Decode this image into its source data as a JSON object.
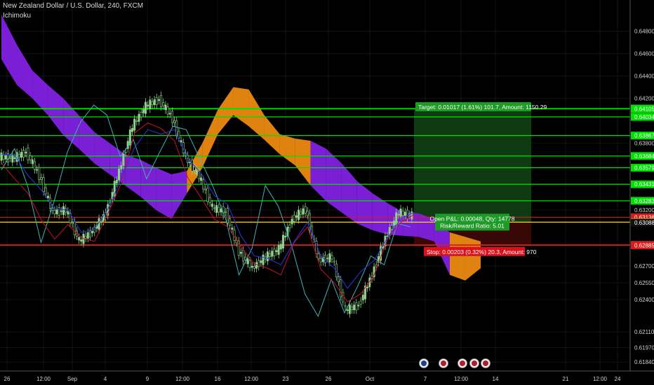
{
  "header": {
    "symbol_line": "New Zealand Dollar / U.S. Dollar, 240, FXCM",
    "indicator": "Ichimoku"
  },
  "colors": {
    "background": "#000000",
    "cloud_bearish": "#7a1fd6",
    "cloud_bullish": "#e0820f",
    "conversion_line": "#2c34e0",
    "base_line": "#c8102e",
    "lagging_span": "#3fb3b3",
    "candle": "#8fd18a",
    "level_green": "#00e000",
    "level_red": "#d81b1b",
    "level_yellow": "#ffd400",
    "profit_zone": "#0f3a12",
    "loss_zone": "#3a0707",
    "axis_text": "#cfcfcf"
  },
  "chart_data": {
    "type": "line",
    "title": "New Zealand Dollar / U.S. Dollar, 240, FXCM",
    "x_ticks": [
      "26",
      "12:00",
      "Sep",
      "4",
      "9",
      "12:00",
      "16",
      "12:00",
      "23",
      "26",
      "Oct",
      "7",
      "12:00",
      "14",
      "21",
      "12:00",
      "24"
    ],
    "y_ticks": [
      0.6184,
      0.6197,
      0.6211,
      0.624,
      0.6255,
      0.627,
      0.6308,
      0.632,
      0.638,
      0.642,
      0.644,
      0.646,
      0.648
    ],
    "y_tick_labels": [
      "0.61840",
      "0.61970",
      "0.62110",
      "0.62400",
      "0.62550",
      "0.62700",
      "0.63088",
      "0.63200",
      "0.63800",
      "0.64200",
      "0.64400",
      "0.64600",
      "0.64800"
    ],
    "ylim": [
      0.6176,
      0.6508
    ],
    "levels": [
      {
        "value": 0.64109,
        "label": "0.64109",
        "color": "green"
      },
      {
        "value": 0.64105,
        "label": "0.64105",
        "color": "green"
      },
      {
        "value": 0.64034,
        "label": "0.64034",
        "color": "green"
      },
      {
        "value": 0.63867,
        "label": "0.63867",
        "color": "green"
      },
      {
        "value": 0.63684,
        "label": "0.63684",
        "color": "green"
      },
      {
        "value": 0.63579,
        "label": "0.63579",
        "color": "green"
      },
      {
        "value": 0.63431,
        "label": "0.63431",
        "color": "green"
      },
      {
        "value": 0.63283,
        "label": "0.63283",
        "color": "green"
      },
      {
        "value": 0.63136,
        "label": "0.63136",
        "color": "red"
      },
      {
        "value": 0.63092,
        "label": "0.63092",
        "color": "yellow"
      },
      {
        "value": 0.62889,
        "label": "0.62889",
        "color": "red"
      },
      {
        "value": 0.62885,
        "label": "0.62885",
        "color": "red"
      }
    ],
    "current_price_label": "0.63088",
    "position": {
      "entry": 0.63092,
      "target": 0.64109,
      "stop": 0.62889,
      "target_text": "Target: 0.01017 (1.61%) 101.7, Amount: 1150.29",
      "open_text_1": "Open P&L: 0.00048, Qty: 14778",
      "open_text_2": "Risk/Reward Ratio: 5.01",
      "stop_text": "Stop: 0.00203 (0.32%) 20.3, Amount: 970"
    },
    "cloud_top": [
      0.6495,
      0.6468,
      0.6445,
      0.6432,
      0.642,
      0.6405,
      0.639,
      0.638,
      0.637,
      0.6365,
      0.6358,
      0.6352,
      0.6355,
      0.638,
      0.641,
      0.643,
      0.6428,
      0.6405,
      0.6388,
      0.6384,
      0.6382,
      0.6375,
      0.6362,
      0.6346,
      0.6335,
      0.6326,
      0.6318,
      0.6317,
      0.6312,
      0.63,
      0.6296,
      0.6292
    ],
    "cloud_bottom": [
      0.6455,
      0.6432,
      0.642,
      0.6405,
      0.6387,
      0.6375,
      0.6362,
      0.6352,
      0.6342,
      0.6332,
      0.632,
      0.6312,
      0.6335,
      0.6358,
      0.6388,
      0.6405,
      0.6395,
      0.6383,
      0.637,
      0.636,
      0.6342,
      0.6328,
      0.6318,
      0.6308,
      0.6302,
      0.6298,
      0.6297,
      0.6296,
      0.6292,
      0.6262,
      0.6257,
      0.6268
    ],
    "close": [
      0.6368,
      0.6366,
      0.6372,
      0.6351,
      0.6318,
      0.632,
      0.6292,
      0.6301,
      0.6317,
      0.6355,
      0.6395,
      0.6413,
      0.6419,
      0.6402,
      0.6367,
      0.635,
      0.6322,
      0.6318,
      0.6283,
      0.6268,
      0.6278,
      0.6285,
      0.6312,
      0.6321,
      0.6275,
      0.6278,
      0.623,
      0.6235,
      0.6262,
      0.6295,
      0.6318,
      0.6315
    ],
    "tenkan": [
      0.637,
      0.6369,
      0.6351,
      0.6338,
      0.6321,
      0.632,
      0.63,
      0.6303,
      0.6321,
      0.6348,
      0.6376,
      0.6392,
      0.6388,
      0.6392,
      0.6366,
      0.6353,
      0.6333,
      0.6325,
      0.6297,
      0.6279,
      0.6277,
      0.6271,
      0.6292,
      0.6309,
      0.6279,
      0.6268,
      0.625,
      0.6265,
      0.6275,
      0.6295,
      0.6312,
      0.6318
    ],
    "kijun": [
      0.6362,
      0.6348,
      0.6335,
      0.6311,
      0.6294,
      0.6307,
      0.6295,
      0.6292,
      0.6317,
      0.6344,
      0.6389,
      0.6398,
      0.6393,
      0.6382,
      0.6349,
      0.6331,
      0.6312,
      0.6305,
      0.6287,
      0.6272,
      0.6268,
      0.6262,
      0.6291,
      0.6305,
      0.6267,
      0.6255,
      0.6238,
      0.6245,
      0.6262,
      0.6294,
      0.6309,
      0.6316
    ],
    "chikou": [
      0.6356,
      0.6375,
      0.6341,
      0.6291,
      0.6328,
      0.6372,
      0.6399,
      0.6414,
      0.6405,
      0.6368,
      0.6383,
      0.6348,
      0.6372,
      0.6395,
      0.6392,
      0.6367,
      0.6342,
      0.6312,
      0.6262,
      0.6286,
      0.6342,
      0.6323,
      0.6288,
      0.6245,
      0.6225,
      0.6258,
      0.6228,
      0.6252,
      0.6279,
      0.6271,
      0.6308,
      0.6305
    ]
  }
}
